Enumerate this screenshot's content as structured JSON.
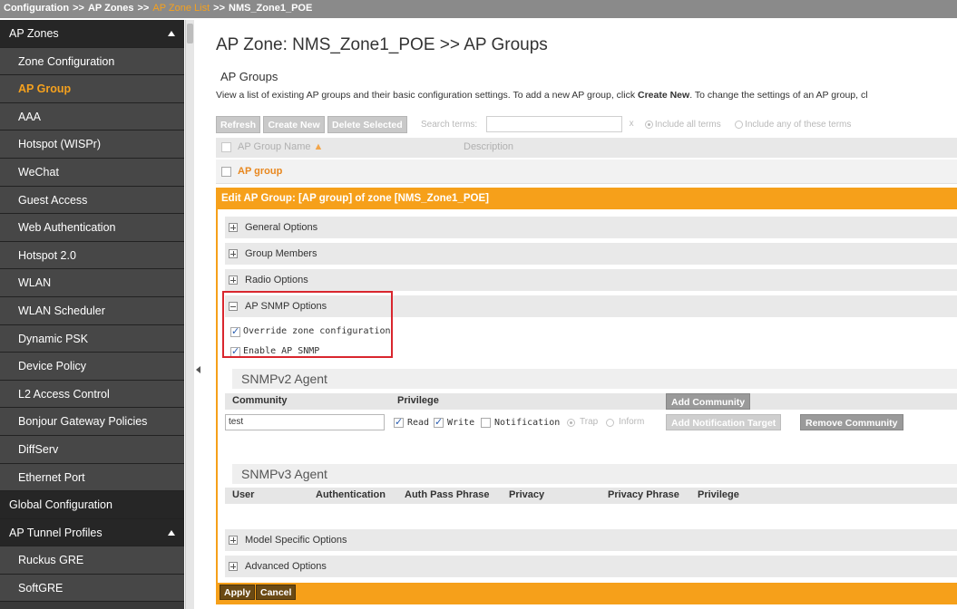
{
  "breadcrumb": {
    "part1": "Configuration",
    "part2": "AP Zones",
    "part3": "AP Zone List",
    "part4": "NMS_Zone1_POE",
    "separator": ">>"
  },
  "sidebar": {
    "items": [
      {
        "label": "AP Zones",
        "type": "header"
      },
      {
        "label": "Zone Configuration"
      },
      {
        "label": "AP Group",
        "active": true
      },
      {
        "label": "AAA"
      },
      {
        "label": "Hotspot (WISPr)"
      },
      {
        "label": "WeChat"
      },
      {
        "label": "Guest Access"
      },
      {
        "label": "Web Authentication"
      },
      {
        "label": "Hotspot 2.0"
      },
      {
        "label": "WLAN"
      },
      {
        "label": "WLAN Scheduler"
      },
      {
        "label": "Dynamic PSK"
      },
      {
        "label": "Device Policy"
      },
      {
        "label": "L2 Access Control"
      },
      {
        "label": "Bonjour Gateway Policies"
      },
      {
        "label": "DiffServ"
      },
      {
        "label": "Ethernet Port"
      },
      {
        "label": "Global Configuration",
        "type": "header"
      },
      {
        "label": "AP Tunnel Profiles",
        "type": "header"
      },
      {
        "label": "Ruckus GRE"
      },
      {
        "label": "SoftGRE"
      }
    ]
  },
  "main": {
    "title": "AP Zone: NMS_Zone1_POE >> AP Groups",
    "section": "AP Groups",
    "intro_start": "View a list of existing AP groups and their basic configuration settings. To add a new AP group, click ",
    "intro_bold": "Create New",
    "intro_end": ". To change the settings of an AP group, cl"
  },
  "toolbar": {
    "refresh": "Refresh",
    "create_new": "Create New",
    "delete_selected": "Delete Selected",
    "search_label": "Search terms:",
    "search_value": "",
    "clear": "x",
    "include_all": "Include all terms",
    "include_any": "Include any of these terms"
  },
  "grid": {
    "col_name": "AP Group Name",
    "col_desc": "Description",
    "rows": [
      {
        "name": "AP group",
        "description": ""
      }
    ]
  },
  "edit": {
    "header": "Edit AP Group: [AP group] of zone [NMS_Zone1_POE]",
    "general": "General Options",
    "members": "Group Members",
    "radio": "Radio Options",
    "snmp": "AP SNMP Options",
    "override": "Override zone configuration",
    "enable_snmp": "Enable AP SNMP",
    "snmpv2_title": "SNMPv2 Agent",
    "v2_community": "Community",
    "v2_privilege": "Privilege",
    "add_community": "Add Community",
    "community_value": "test",
    "read": "Read",
    "write": "Write",
    "notification": "Notification",
    "trap": "Trap",
    "inform": "Inform",
    "add_notification_target": "Add Notification Target",
    "remove_community": "Remove Community",
    "snmpv3_title": "SNMPv3 Agent",
    "v3_user": "User",
    "v3_auth": "Authentication",
    "v3_auth_pass": "Auth Pass Phrase",
    "v3_privacy": "Privacy",
    "v3_privacy_phrase": "Privacy Phrase",
    "v3_privilege": "Privilege",
    "model_specific": "Model Specific Options",
    "advanced": "Advanced Options",
    "apply": "Apply",
    "cancel": "Cancel"
  },
  "colors": {
    "accent": "#f6a01a",
    "sidebar_bg": "#474747",
    "sidebar_header_bg": "#262626",
    "highlight_border": "#d9262e"
  }
}
